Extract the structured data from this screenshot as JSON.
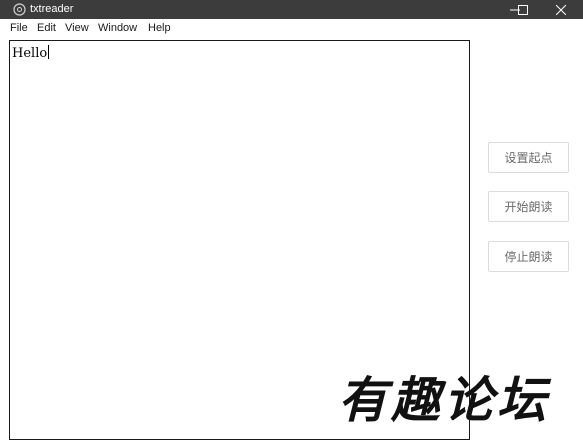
{
  "window": {
    "title": "txtreader",
    "icon": "app-icon"
  },
  "menu": {
    "items": [
      "File",
      "Edit",
      "View",
      "Window",
      "Help"
    ]
  },
  "editor": {
    "content": "Hello"
  },
  "buttons": {
    "set_start": "设置起点",
    "start_reading": "开始朗读",
    "stop_reading": "停止朗读"
  },
  "watermark": {
    "text": "有趣论坛"
  }
}
